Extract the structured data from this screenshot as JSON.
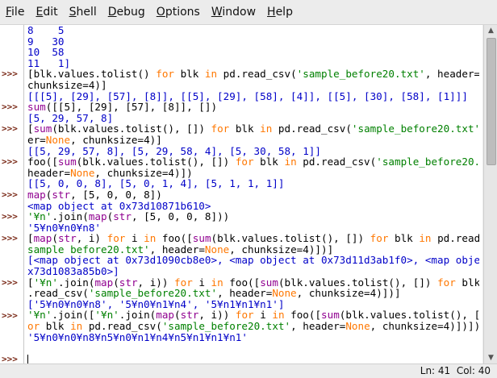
{
  "menubar": {
    "items": [
      {
        "label": "File",
        "mnemonic": "F"
      },
      {
        "label": "Edit",
        "mnemonic": "E"
      },
      {
        "label": "Shell",
        "mnemonic": "S"
      },
      {
        "label": "Debug",
        "mnemonic": "D"
      },
      {
        "label": "Options",
        "mnemonic": "O"
      },
      {
        "label": "Window",
        "mnemonic": "W"
      },
      {
        "label": "Help",
        "mnemonic": "H"
      }
    ]
  },
  "editor": {
    "prompt_symbol": ">>>",
    "colors": {
      "default": "#000000",
      "output": "#0000c8",
      "string": "#008000",
      "keyword": "#ff7700",
      "builtin": "#900090",
      "prompt": "#7a2a18"
    },
    "lines": [
      {
        "prompt": false,
        "segs": [
          [
            "o",
            "8    5"
          ]
        ]
      },
      {
        "prompt": false,
        "segs": [
          [
            "o",
            "9   30"
          ]
        ]
      },
      {
        "prompt": false,
        "segs": [
          [
            "o",
            "10  58"
          ]
        ]
      },
      {
        "prompt": false,
        "segs": [
          [
            "o",
            "11   1]"
          ]
        ]
      },
      {
        "prompt": true,
        "segs": [
          [
            "d",
            "[blk.values.tolist() "
          ],
          [
            "k",
            "for"
          ],
          [
            "d",
            " blk "
          ],
          [
            "k",
            "in"
          ],
          [
            "d",
            " pd.read_csv("
          ],
          [
            "s",
            "'sample_before20.txt'"
          ],
          [
            "d",
            ", header="
          ],
          [
            "k",
            "None"
          ],
          [
            "d",
            ","
          ]
        ]
      },
      {
        "prompt": false,
        "segs": [
          [
            "d",
            "chunksize=4)]"
          ]
        ]
      },
      {
        "prompt": false,
        "segs": [
          [
            "o",
            "[[[5], [29], [57], [8]], [[5], [29], [58], [4]], [[5], [30], [58], [1]]]"
          ]
        ]
      },
      {
        "prompt": true,
        "segs": [
          [
            "b",
            "sum"
          ],
          [
            "d",
            "([[5], [29], [57], [8]], [])"
          ]
        ]
      },
      {
        "prompt": false,
        "segs": [
          [
            "o",
            "[5, 29, 57, 8]"
          ]
        ]
      },
      {
        "prompt": true,
        "segs": [
          [
            "d",
            "["
          ],
          [
            "b",
            "sum"
          ],
          [
            "d",
            "(blk.values.tolist(), []) "
          ],
          [
            "k",
            "for"
          ],
          [
            "d",
            " blk "
          ],
          [
            "k",
            "in"
          ],
          [
            "d",
            " pd.read_csv("
          ],
          [
            "s",
            "'sample_before20.txt'"
          ],
          [
            "d",
            ", head"
          ]
        ]
      },
      {
        "prompt": false,
        "segs": [
          [
            "d",
            "er="
          ],
          [
            "k",
            "None"
          ],
          [
            "d",
            ", chunksize=4)]"
          ]
        ]
      },
      {
        "prompt": false,
        "segs": [
          [
            "o",
            "[[5, 29, 57, 8], [5, 29, 58, 4], [5, 30, 58, 1]]"
          ]
        ]
      },
      {
        "prompt": true,
        "segs": [
          [
            "d",
            "foo(["
          ],
          [
            "b",
            "sum"
          ],
          [
            "d",
            "(blk.values.tolist(), []) "
          ],
          [
            "k",
            "for"
          ],
          [
            "d",
            " blk "
          ],
          [
            "k",
            "in"
          ],
          [
            "d",
            " pd.read_csv("
          ],
          [
            "s",
            "'sample_before20.txt'"
          ],
          [
            "d",
            ","
          ]
        ]
      },
      {
        "prompt": false,
        "segs": [
          [
            "d",
            "header="
          ],
          [
            "k",
            "None"
          ],
          [
            "d",
            ", chunksize=4)])"
          ]
        ]
      },
      {
        "prompt": false,
        "segs": [
          [
            "o",
            "[[5, 0, 0, 8], [5, 0, 1, 4], [5, 1, 1, 1]]"
          ]
        ]
      },
      {
        "prompt": true,
        "segs": [
          [
            "b",
            "map"
          ],
          [
            "d",
            "("
          ],
          [
            "b",
            "str"
          ],
          [
            "d",
            ", [5, 0, 0, 8])"
          ]
        ]
      },
      {
        "prompt": false,
        "segs": [
          [
            "o",
            "<map object at 0x73d10871b610>"
          ]
        ]
      },
      {
        "prompt": true,
        "segs": [
          [
            "s",
            "'¥n'"
          ],
          [
            "d",
            ".join("
          ],
          [
            "b",
            "map"
          ],
          [
            "d",
            "("
          ],
          [
            "b",
            "str"
          ],
          [
            "d",
            ", [5, 0, 0, 8]))"
          ]
        ]
      },
      {
        "prompt": false,
        "segs": [
          [
            "o",
            "'5¥n0¥n0¥n8'"
          ]
        ]
      },
      {
        "prompt": true,
        "segs": [
          [
            "d",
            "["
          ],
          [
            "b",
            "map"
          ],
          [
            "d",
            "("
          ],
          [
            "b",
            "str"
          ],
          [
            "d",
            ", i) "
          ],
          [
            "k",
            "for"
          ],
          [
            "d",
            " i "
          ],
          [
            "k",
            "in"
          ],
          [
            "d",
            " foo(["
          ],
          [
            "b",
            "sum"
          ],
          [
            "d",
            "(blk.values.tolist(), []) "
          ],
          [
            "k",
            "for"
          ],
          [
            "d",
            " blk "
          ],
          [
            "k",
            "in"
          ],
          [
            "d",
            " pd.read_csv("
          ],
          [
            "s",
            "'"
          ]
        ]
      },
      {
        "prompt": false,
        "segs": [
          [
            "s",
            "sample_before20.txt'"
          ],
          [
            "d",
            ", header="
          ],
          [
            "k",
            "None"
          ],
          [
            "d",
            ", chunksize=4)])]"
          ]
        ]
      },
      {
        "prompt": false,
        "segs": [
          [
            "o",
            "[<map object at 0x73d1090cb8e0>, <map object at 0x73d11d3ab1f0>, <map object at 0"
          ]
        ]
      },
      {
        "prompt": false,
        "segs": [
          [
            "o",
            "x73d1083a85b0>]"
          ]
        ]
      },
      {
        "prompt": true,
        "segs": [
          [
            "d",
            "["
          ],
          [
            "s",
            "'¥n'"
          ],
          [
            "d",
            ".join("
          ],
          [
            "b",
            "map"
          ],
          [
            "d",
            "("
          ],
          [
            "b",
            "str"
          ],
          [
            "d",
            ", i)) "
          ],
          [
            "k",
            "for"
          ],
          [
            "d",
            " i "
          ],
          [
            "k",
            "in"
          ],
          [
            "d",
            " foo(["
          ],
          [
            "b",
            "sum"
          ],
          [
            "d",
            "(blk.values.tolist(), []) "
          ],
          [
            "k",
            "for"
          ],
          [
            "d",
            " blk "
          ],
          [
            "k",
            "in"
          ],
          [
            "d",
            " pd"
          ]
        ]
      },
      {
        "prompt": false,
        "segs": [
          [
            "d",
            ".read_csv("
          ],
          [
            "s",
            "'sample_before20.txt'"
          ],
          [
            "d",
            ", header="
          ],
          [
            "k",
            "None"
          ],
          [
            "d",
            ", chunksize=4)])]"
          ]
        ]
      },
      {
        "prompt": false,
        "segs": [
          [
            "o",
            "['5¥n0¥n0¥n8', '5¥n0¥n1¥n4', '5¥n1¥n1¥n1']"
          ]
        ]
      },
      {
        "prompt": true,
        "segs": [
          [
            "s",
            "'¥n'"
          ],
          [
            "d",
            ".join(["
          ],
          [
            "s",
            "'¥n'"
          ],
          [
            "d",
            ".join("
          ],
          [
            "b",
            "map"
          ],
          [
            "d",
            "("
          ],
          [
            "b",
            "str"
          ],
          [
            "d",
            ", i)) "
          ],
          [
            "k",
            "for"
          ],
          [
            "d",
            " i "
          ],
          [
            "k",
            "in"
          ],
          [
            "d",
            " foo(["
          ],
          [
            "b",
            "sum"
          ],
          [
            "d",
            "(blk.values.tolist(), []) "
          ],
          [
            "k",
            "f"
          ]
        ]
      },
      {
        "prompt": false,
        "segs": [
          [
            "k",
            "or"
          ],
          [
            "d",
            " blk "
          ],
          [
            "k",
            "in"
          ],
          [
            "d",
            " pd.read_csv("
          ],
          [
            "s",
            "'sample_before20.txt'"
          ],
          [
            "d",
            ", header="
          ],
          [
            "k",
            "None"
          ],
          [
            "d",
            ", chunksize=4)])])"
          ]
        ]
      },
      {
        "prompt": false,
        "segs": [
          [
            "o",
            "'5¥n0¥n0¥n8¥n5¥n0¥n1¥n4¥n5¥n1¥n1¥n1'"
          ]
        ]
      },
      {
        "prompt": false,
        "segs": []
      },
      {
        "prompt": true,
        "segs": [],
        "cursor": true
      }
    ]
  },
  "status": {
    "text": "Ln: 41  Col: 40"
  }
}
